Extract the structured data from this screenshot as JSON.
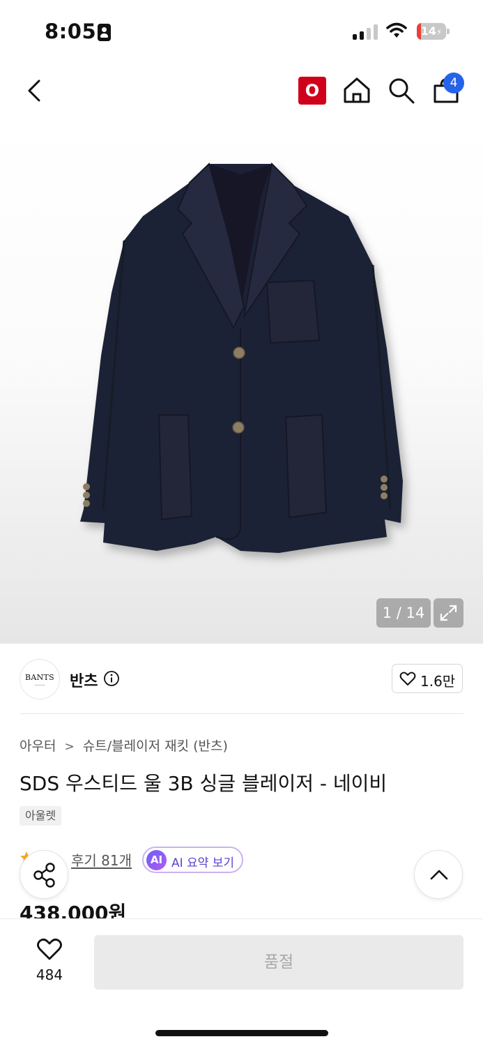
{
  "status_bar": {
    "time": "8:05",
    "battery_level": "14",
    "battery_fraction": 0.14,
    "battery_color": "#e8413a",
    "signal_bars_active": 2,
    "signal_bars_total": 4
  },
  "header": {
    "o_badge": "O",
    "cart_count": "4",
    "icons": [
      "chevron-left-icon",
      "home-icon",
      "search-icon",
      "shopping-bag-icon"
    ]
  },
  "gallery": {
    "counter": "1 / 14",
    "image_subject": "navy single-breasted wool blazer"
  },
  "brand": {
    "logo_text": "BANTS",
    "name": "반츠",
    "like_count": "1.6만"
  },
  "product": {
    "breadcrumb": [
      "아우터",
      "슈트/블레이저 재킷 (반츠)"
    ],
    "title": "SDS 우스티드 울 3B 싱글 블레이저 - 네이비",
    "tag": "아울렛",
    "review_link": "후기 81개",
    "ai_badge": "AI",
    "ai_summary_label": "AI 요약 보기",
    "price": "438,000원"
  },
  "bottom_bar": {
    "wish_count": "484",
    "primary_button": "품절"
  },
  "colors": {
    "brand_red": "#d0021b",
    "badge_blue": "#2563eb",
    "ai_purple": "#5b3fd0",
    "jacket_navy": "#1e2233"
  }
}
